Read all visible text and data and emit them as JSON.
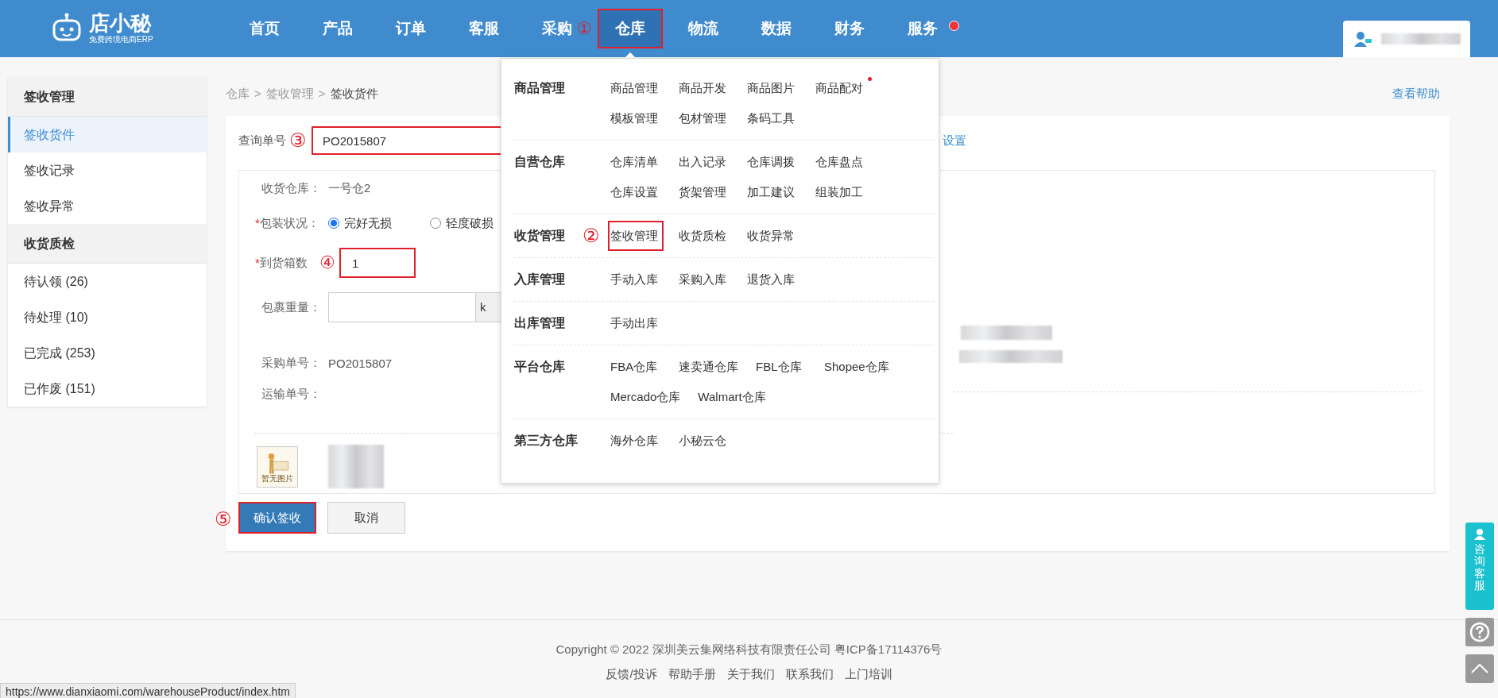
{
  "header": {
    "logo": {
      "name": "店小秘",
      "tagline": "免费跨境电商ERP"
    },
    "nav": [
      {
        "label": "首页",
        "selected": false,
        "highlighted": false
      },
      {
        "label": "产品",
        "selected": false,
        "highlighted": false
      },
      {
        "label": "订单",
        "selected": false,
        "highlighted": false
      },
      {
        "label": "客服",
        "selected": false,
        "highlighted": false
      },
      {
        "label": "采购",
        "selected": false,
        "highlighted": false
      },
      {
        "label": "仓库",
        "selected": true,
        "highlighted": true,
        "annotation": "①"
      },
      {
        "label": "物流",
        "selected": false,
        "highlighted": false
      },
      {
        "label": "数据",
        "selected": false,
        "highlighted": false
      },
      {
        "label": "财务",
        "selected": false,
        "highlighted": false
      },
      {
        "label": "服务",
        "selected": false,
        "highlighted": false,
        "badge": true
      }
    ]
  },
  "dropdown": {
    "groups": [
      {
        "title": "商品管理",
        "items": [
          {
            "label": "商品管理",
            "highlighted": false
          },
          {
            "label": "商品开发",
            "highlighted": false
          },
          {
            "label": "商品图片",
            "highlighted": false
          },
          {
            "label": "商品配对",
            "highlighted": false,
            "badge": true
          },
          {
            "label": "模板管理",
            "highlighted": false
          },
          {
            "label": "包材管理",
            "highlighted": false
          },
          {
            "label": "条码工具",
            "highlighted": false
          }
        ]
      },
      {
        "title": "自营仓库",
        "items": [
          {
            "label": "仓库清单",
            "highlighted": false
          },
          {
            "label": "出入记录",
            "highlighted": false
          },
          {
            "label": "仓库调拨",
            "highlighted": false
          },
          {
            "label": "仓库盘点",
            "highlighted": false
          },
          {
            "label": "仓库设置",
            "highlighted": false
          },
          {
            "label": "货架管理",
            "highlighted": false
          },
          {
            "label": "加工建议",
            "highlighted": false
          },
          {
            "label": "组装加工",
            "highlighted": false
          }
        ]
      },
      {
        "title": "收货管理",
        "annotation": "②",
        "items": [
          {
            "label": "签收管理",
            "highlighted": true
          },
          {
            "label": "收货质检",
            "highlighted": false
          },
          {
            "label": "收货异常",
            "highlighted": false
          }
        ]
      },
      {
        "title": "入库管理",
        "items": [
          {
            "label": "手动入库",
            "highlighted": false
          },
          {
            "label": "采购入库",
            "highlighted": false
          },
          {
            "label": "退货入库",
            "highlighted": false
          }
        ]
      },
      {
        "title": "出库管理",
        "items": [
          {
            "label": "手动出库",
            "highlighted": false
          }
        ]
      },
      {
        "title": "平台仓库",
        "items": [
          {
            "label": "FBA仓库",
            "highlighted": false
          },
          {
            "label": "速卖通仓库",
            "highlighted": false
          },
          {
            "label": "FBL仓库",
            "highlighted": false
          },
          {
            "label": "Shopee仓库",
            "highlighted": false
          },
          {
            "label": "Mercado仓库",
            "highlighted": false
          },
          {
            "label": "Walmart仓库",
            "highlighted": false
          }
        ]
      },
      {
        "title": "第三方仓库",
        "items": [
          {
            "label": "海外仓库",
            "highlighted": false
          },
          {
            "label": "小秘云仓",
            "highlighted": false
          }
        ]
      }
    ]
  },
  "sidebar": {
    "groups": [
      {
        "title": "签收管理",
        "items": [
          {
            "label": "签收货件",
            "selected": true
          },
          {
            "label": "签收记录",
            "selected": false
          },
          {
            "label": "签收异常",
            "selected": false
          }
        ]
      },
      {
        "title": "收货质检",
        "items": [
          {
            "label": "待认领 (26)",
            "selected": false
          },
          {
            "label": "待处理 (10)",
            "selected": false
          },
          {
            "label": "已完成 (253)",
            "selected": false
          },
          {
            "label": "已作废 (151)",
            "selected": false
          }
        ]
      }
    ]
  },
  "breadcrumb": {
    "items": [
      "仓库",
      "签收管理",
      "签收货件"
    ],
    "separator": ">"
  },
  "help_link": "查看帮助",
  "query": {
    "label": "查询单号",
    "value": "PO2015807",
    "annotation": "③",
    "highlighted": true,
    "settings_link": "设置"
  },
  "form": {
    "rows": [
      {
        "kind": "text",
        "label": "收货仓库：",
        "value": "一号仓2"
      },
      {
        "kind": "radio",
        "label": "包装状况：",
        "required_mark": "*",
        "options": [
          {
            "label": "完好无损",
            "selected": true
          },
          {
            "label": "轻度破损",
            "selected": false
          }
        ]
      },
      {
        "kind": "input",
        "label": "到货箱数",
        "required_mark": "*",
        "value": "1",
        "annotation": "④",
        "highlighted": true
      },
      {
        "kind": "addon",
        "label": "包裹重量：",
        "addon": "k"
      },
      {
        "kind": "text",
        "label": "采购单号：",
        "value": "PO2015807"
      },
      {
        "kind": "text",
        "label": "运输单号："
      }
    ],
    "product_image": {
      "caption": "暂无图片"
    }
  },
  "buttons": [
    {
      "label": "确认签收",
      "kind": "primary",
      "annotation": "⑤",
      "highlighted": true
    },
    {
      "label": "取消",
      "kind": "default",
      "highlighted": false
    }
  ],
  "footer": {
    "copyright": "Copyright © 2022 深圳美云集网络科技有限责任公司  粤ICP备17114376号",
    "links": [
      "反馈/投诉",
      "帮助手册",
      "关于我们",
      "联系我们",
      "上门培训"
    ]
  },
  "float": {
    "consult": "咨询客服"
  },
  "status_url": "https://www.dianxiaomi.com/warehouseProduct/index.htm"
}
